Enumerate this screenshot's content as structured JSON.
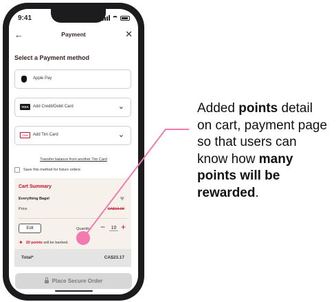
{
  "status_bar": {
    "time": "9:41"
  },
  "nav": {
    "back_icon": "arrow-left-icon",
    "title": "Payment",
    "close_icon": "close-icon"
  },
  "section_title": "Select a Payment method",
  "payment_options": [
    {
      "label": "Apple Pay",
      "icon": "apple-icon"
    },
    {
      "label": "Add Credit/Debit Card",
      "icon": "visa-card-icon",
      "badge": "VISA"
    },
    {
      "label": "Add Tim Card",
      "icon": "tim-card-icon",
      "badge": "Tims"
    }
  ],
  "transfer_link": "Transfer balance from another Tim Card",
  "save_method_label": "Save this method for future orders",
  "cart": {
    "title": "Cart Summary",
    "item_name": "Everything Bagel",
    "price_label": "Price",
    "price_value": "CA$19.99",
    "edit_label": "Edit",
    "quantity_label": "Quantity:",
    "quantity_value": "10",
    "points_bold": "20 points",
    "points_rest": " will be banked."
  },
  "total": {
    "label": "Total*",
    "value": "CA$23.17"
  },
  "place_order_label": "Place Secure Order",
  "annotation": {
    "line1_a": "Added ",
    "line1_b": "points",
    "line1_c": " detail",
    "line2": "on cart, payment page",
    "line3": "so that users can",
    "line4_a": "know how ",
    "line4_b": "many",
    "line5": "points will be",
    "line6_a": "rewarded",
    "line6_b": "."
  },
  "colors": {
    "accent": "#c8102e",
    "annotation_pink": "#f37ab1",
    "phone_frame": "#1c1c1e"
  }
}
